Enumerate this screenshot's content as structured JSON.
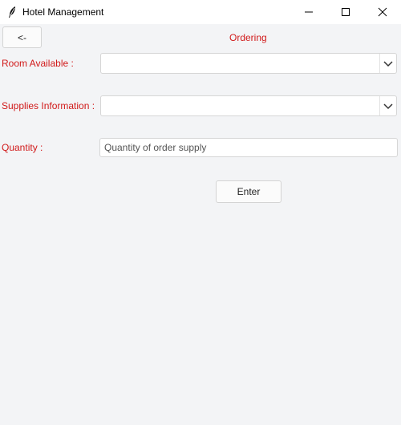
{
  "window": {
    "title": "Hotel Management",
    "icon": "feather-icon",
    "controls": [
      "minimize-icon",
      "maximize-icon",
      "close-icon"
    ]
  },
  "header": {
    "back_label": "<-",
    "title": "Ordering"
  },
  "form": {
    "room_label": "Room Available :",
    "room_value": "",
    "supplies_label": "Supplies Information :",
    "supplies_value": "",
    "quantity_label": "Quantity :",
    "quantity_placeholder": "Quantity of order supply",
    "enter_label": "Enter"
  },
  "colors": {
    "accent_red": "#d11a1a",
    "background": "#f3f4f6"
  }
}
